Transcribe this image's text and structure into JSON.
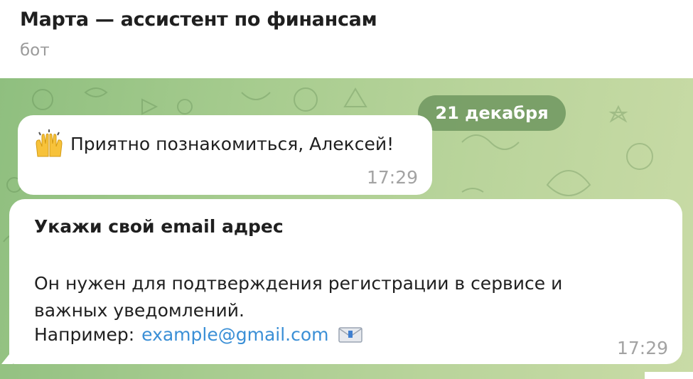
{
  "header": {
    "title": "Марта — ассистент по финансам",
    "subtitle": "бот"
  },
  "chat": {
    "date_divider": "21 декабря",
    "messages": [
      {
        "icon": "raising-hands-emoji",
        "text": "Приятно познакомиться, Алексей!",
        "time": "17:29"
      },
      {
        "title": "Укажи свой email адрес",
        "body": "Он нужен для подтверждения регистрации в сервисе и важных уведомлений.",
        "example_label": "Например:",
        "example_email": "example@gmail.com",
        "icon": "envelope-emoji",
        "time": "17:29"
      }
    ]
  },
  "colors": {
    "background_green": "#a7cc8f",
    "link": "#3a8fd6",
    "date_pill": "#6e965f"
  }
}
